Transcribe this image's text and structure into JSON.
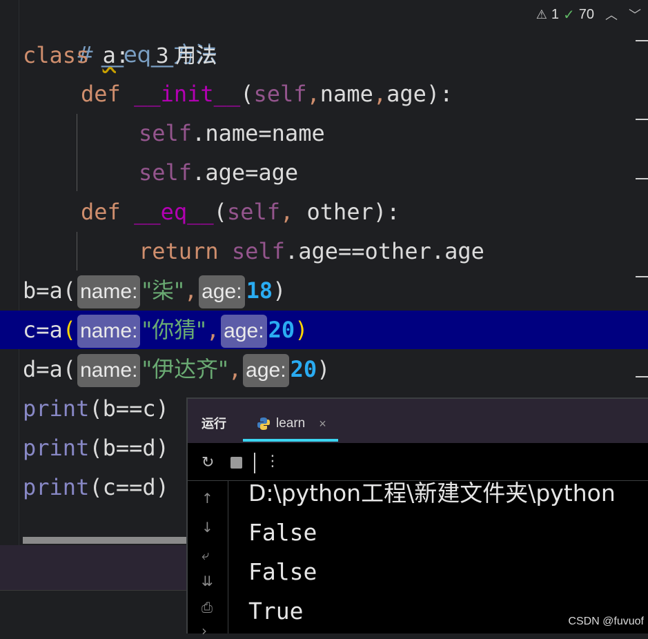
{
  "editor": {
    "status": {
      "warnings": "1",
      "checks": "70"
    },
    "lines": {
      "l1_comment": "# __eq__方法",
      "l2_class": "class",
      "l2_name": "a",
      "l2_colon": ":",
      "l2_usages": "3 用法",
      "l3_def": "def",
      "l3_fn": "__init__",
      "l3_open": "(",
      "l3_self": "self",
      "l3_comma1": ",",
      "l3_p1": "name",
      "l3_comma2": ",",
      "l3_p2": "age",
      "l3_close": "):",
      "l4_self": "self",
      "l4_rest": ".name=name",
      "l5_self": "self",
      "l5_rest": ".age=age",
      "l6_def": "def",
      "l6_fn": "__eq__",
      "l6_open": "(",
      "l6_self": "self",
      "l6_comma": ",",
      "l6_rest": " other):",
      "l7_return": "return",
      "l7_self": "self",
      "l7_rest": ".age==other.age",
      "l8_pre": "b=a(",
      "l8_hint1": "name:",
      "l8_str": "\"柒\"",
      "l8_comma": ",",
      "l8_hint2": "age:",
      "l8_num": "18",
      "l8_close": ")",
      "l9_pre": "c=a",
      "l9_open": "(",
      "l9_hint1": "name:",
      "l9_str": "\"你猜\"",
      "l9_comma": ",",
      "l9_hint2": "age:",
      "l9_num": "20",
      "l9_close": ")",
      "l10_pre": "d=a(",
      "l10_hint1": "name:",
      "l10_str": "\"伊达齐\"",
      "l10_comma": ",",
      "l10_hint2": "age:",
      "l10_num": "20",
      "l10_close": ")",
      "l11_print": "print",
      "l11_rest": "(b==c)",
      "l12_print": "print",
      "l12_rest": "(b==d)",
      "l13_print": "print",
      "l13_rest": "(c==d)"
    }
  },
  "run_panel": {
    "label": "运行",
    "tab_label": "learn",
    "tab_close": "×",
    "output": [
      "D:\\python工程\\新建文件夹\\python",
      "False",
      "False",
      "True"
    ]
  },
  "watermark": "CSDN @fuvuof",
  "colors": {
    "highlight_line": "#000080",
    "tab_underline": "#3bd4f0",
    "background": "#1e1f22"
  },
  "icons": [
    "warning-icon",
    "check-icon",
    "chevron-up-icon",
    "chevron-down-icon",
    "python-icon",
    "close-icon",
    "rerun-icon",
    "stop-icon",
    "more-icon",
    "arrow-up-icon",
    "arrow-down-icon",
    "soft-wrap-icon",
    "scroll-to-end-icon",
    "print-icon",
    "expand-icon"
  ]
}
